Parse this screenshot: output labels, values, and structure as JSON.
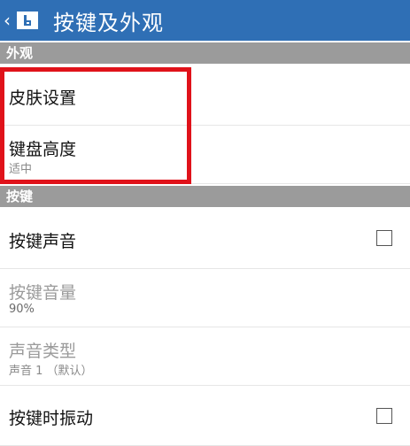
{
  "header": {
    "back_glyph": "‹",
    "title": "按键及外观",
    "bar_color": "#2f6fb5",
    "icon": "app-logo-icon"
  },
  "sections": {
    "appearance": {
      "label": "外观",
      "skin": {
        "title": "皮肤设置"
      },
      "keyboard_height": {
        "title": "键盘高度",
        "value": "适中"
      }
    },
    "keys": {
      "label": "按键",
      "key_sound": {
        "title": "按键声音",
        "checked": false
      },
      "key_volume": {
        "title": "按键音量",
        "value": "90%"
      },
      "sound_type": {
        "title": "声音类型",
        "value": "声音 1 （默认）"
      },
      "key_vibration": {
        "title": "按键时振动",
        "checked": false
      }
    }
  },
  "annotation": {
    "highlight_color": "#e0121a"
  }
}
